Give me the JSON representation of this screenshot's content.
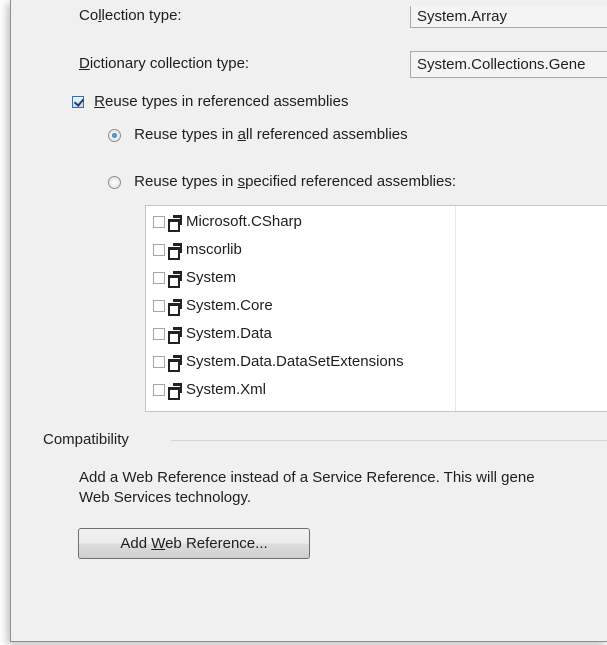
{
  "settings": {
    "collection_type": {
      "label_pre": "Co",
      "label_u": "l",
      "label_post": "lection type:",
      "value": "System.Array"
    },
    "dictionary_type": {
      "label_u": "D",
      "label_post": "ictionary collection type:",
      "value": "System.Collections.Gene"
    },
    "reuse_types": {
      "checked": true,
      "label_u": "R",
      "label_post": "euse types in referenced assemblies"
    },
    "reuse_all": {
      "selected": true,
      "label_pre": "Reuse types in ",
      "label_u": "a",
      "label_post": "ll referenced assemblies"
    },
    "reuse_specified": {
      "selected": false,
      "label_pre": "Reuse types in ",
      "label_u": "s",
      "label_post": "pecified referenced assemblies:"
    }
  },
  "assemblies": [
    {
      "name": "Microsoft.CSharp",
      "checked": false,
      "icon": "assembly-icon"
    },
    {
      "name": "mscorlib",
      "checked": false,
      "icon": "assembly-icon"
    },
    {
      "name": "System",
      "checked": false,
      "icon": "assembly-icon"
    },
    {
      "name": "System.Core",
      "checked": false,
      "icon": "assembly-icon"
    },
    {
      "name": "System.Data",
      "checked": false,
      "icon": "assembly-icon"
    },
    {
      "name": "System.Data.DataSetExtensions",
      "checked": false,
      "icon": "assembly-icon"
    },
    {
      "name": "System.Xml",
      "checked": false,
      "icon": "assembly-icon"
    }
  ],
  "compatibility": {
    "heading": "Compatibility",
    "description_line1": "Add a Web Reference instead of a Service Reference. This will gene",
    "description_line2": "Web Services technology.",
    "button_pre": "Add ",
    "button_u": "W",
    "button_post": "eb Reference..."
  }
}
